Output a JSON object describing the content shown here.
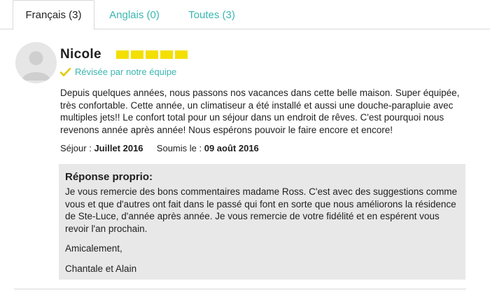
{
  "tabs": [
    {
      "label": "Français (3)",
      "active": true
    },
    {
      "label": "Anglais (0)",
      "active": false
    },
    {
      "label": "Toutes (3)",
      "active": false
    }
  ],
  "review": {
    "author": "Nicole",
    "rating": 5,
    "rating_max": 5,
    "verified_label": "Révisée par notre équipe",
    "body": "Depuis quelques années, nous passons nos vacances dans cette belle maison. Super équipée, très confortable. Cette année, un climatiseur a été installé et aussi une douche-parapluie avec multiples jets!! Le confort total pour un séjour dans un endroit de rêves. C'est pourquoi nous revenons année après année! Nous espérons pouvoir le faire encore et encore!",
    "stay_label": "Séjour :",
    "stay_value": "Juillet 2016",
    "submitted_label": "Soumis le :",
    "submitted_value": "09 août 2016"
  },
  "owner_reply": {
    "title": "Réponse proprio:",
    "text": "Je vous remercie des bons commentaires madame Ross. C'est avec des suggestions comme vous et que d'autres ont fait dans le passé qui font en sorte que nous améliorons la résidence de Ste-Luce, d'année après année. Je vous remercie de votre fidélité et en espérent vous revoir l'an prochain.",
    "closing": "Amicalement,",
    "signature": "Chantale et Alain"
  },
  "colors": {
    "accent": "#3bb6b0",
    "star": "#f3df00",
    "reply_bg": "#e8e8e8"
  },
  "icons": {
    "avatar": "user-silhouette-icon",
    "verified": "checkmark-icon"
  }
}
